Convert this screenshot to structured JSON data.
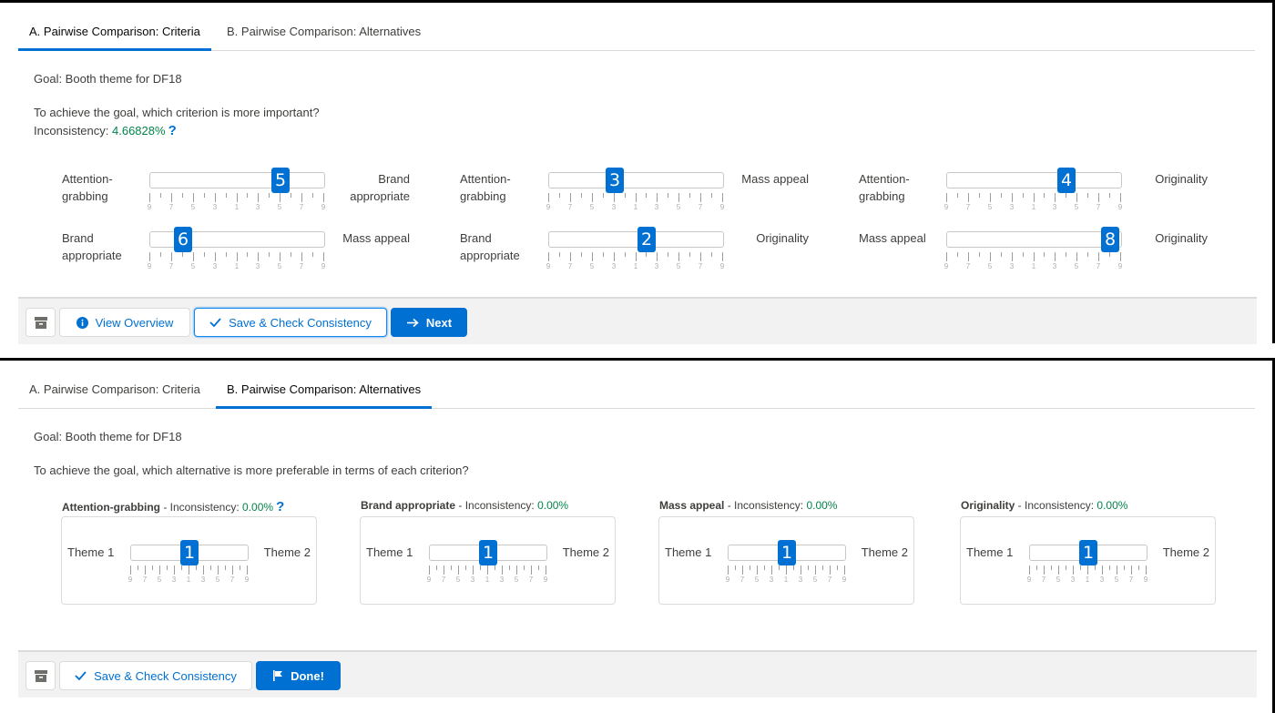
{
  "criteria_view": {
    "tabs": [
      {
        "label": "A. Pairwise Comparison: Criteria",
        "active": true
      },
      {
        "label": "B. Pairwise Comparison: Alternatives",
        "active": false
      }
    ],
    "goal": "Goal: Booth theme for DF18",
    "question": "To achieve the goal, which criterion is more important?",
    "inconsistency_label": "Inconsistency:",
    "inconsistency_value": "4.66828%",
    "help_symbol": "?",
    "scale_labels": [
      "9",
      "7",
      "5",
      "3",
      "1",
      "3",
      "5",
      "7",
      "9"
    ],
    "comparisons": [
      {
        "left": "Attention-grabbing",
        "left_lines": [
          "Attention-",
          "grabbing"
        ],
        "right": "Brand appropriate",
        "right_lines": [
          "Brand",
          "appropriate"
        ],
        "value": "5",
        "position": 0.75
      },
      {
        "left": "Attention-grabbing",
        "left_lines": [
          "Attention-",
          "grabbing"
        ],
        "right": "Mass appeal",
        "right_lines": [
          "Mass appeal"
        ],
        "value": "3",
        "position": 0.375
      },
      {
        "left": "Attention-grabbing",
        "left_lines": [
          "Attention-",
          "grabbing"
        ],
        "right": "Originality",
        "right_lines": [
          "Originality"
        ],
        "value": "4",
        "position": 0.6875
      },
      {
        "left": "Brand appropriate",
        "left_lines": [
          "Brand",
          "appropriate"
        ],
        "right": "Mass appeal",
        "right_lines": [
          "Mass appeal"
        ],
        "value": "6",
        "position": 0.1875
      },
      {
        "left": "Brand appropriate",
        "left_lines": [
          "Brand",
          "appropriate"
        ],
        "right": "Originality",
        "right_lines": [
          "Originality"
        ],
        "value": "2",
        "position": 0.5625
      },
      {
        "left": "Mass appeal",
        "left_lines": [
          "Mass appeal"
        ],
        "right": "Originality",
        "right_lines": [
          "Originality"
        ],
        "value": "8",
        "position": 0.9375
      }
    ],
    "footer": {
      "view_overview": "View Overview",
      "save_check": "Save & Check Consistency",
      "next": "Next"
    }
  },
  "alternatives_view": {
    "tabs": [
      {
        "label": "A. Pairwise Comparison: Criteria",
        "active": false
      },
      {
        "label": "B. Pairwise Comparison: Alternatives",
        "active": true
      }
    ],
    "goal": "Goal: Booth theme for DF18",
    "question": "To achieve the goal, which alternative is more preferable in terms of each criterion?",
    "inconsistency_label": "Inconsistency:",
    "scale_labels": [
      "9",
      "7",
      "5",
      "3",
      "1",
      "3",
      "5",
      "7",
      "9"
    ],
    "criteria": [
      {
        "name": "Attention-grabbing",
        "inconsistency": "0.00%",
        "show_help": true,
        "left": "Theme 1",
        "right": "Theme 2",
        "value": "1",
        "position": 0.5
      },
      {
        "name": "Brand appropriate",
        "inconsistency": "0.00%",
        "show_help": false,
        "left": "Theme 1",
        "right": "Theme 2",
        "value": "1",
        "position": 0.5
      },
      {
        "name": "Mass appeal",
        "inconsistency": "0.00%",
        "show_help": false,
        "left": "Theme 1",
        "right": "Theme 2",
        "value": "1",
        "position": 0.5
      },
      {
        "name": "Originality",
        "inconsistency": "0.00%",
        "show_help": false,
        "left": "Theme 1",
        "right": "Theme 2",
        "value": "1",
        "position": 0.5
      }
    ],
    "help_symbol": "?",
    "footer": {
      "save_check": "Save & Check Consistency",
      "done": "Done!"
    }
  },
  "colors": {
    "brand": "#0070d2",
    "green": "#04844b",
    "border": "#dddbda",
    "footer_bg": "#f3f2f2"
  },
  "icons": {
    "archive": "archive-icon",
    "info": "info-icon",
    "check": "check-icon",
    "arrow": "arrow-right-icon",
    "flag": "flag-icon"
  }
}
